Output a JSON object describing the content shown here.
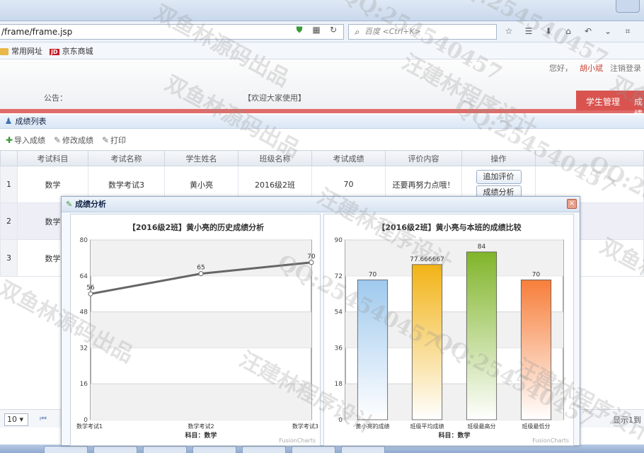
{
  "browser": {
    "url": "/frame/frame.jsp",
    "search_placeholder": "百度 <Ctrl+K>",
    "bookmarks": [
      {
        "label": "常用网址"
      },
      {
        "label": "京东商城"
      }
    ]
  },
  "header": {
    "greeting": "您好，",
    "username": "胡小斌",
    "logout": "注销登录",
    "notice_label": "公告：",
    "notice_text": "【欢迎大家使用】",
    "nav": [
      "学生管理",
      "成绩"
    ]
  },
  "panel": {
    "title": "成绩列表",
    "toolbar": [
      "导入成绩",
      "修改成绩",
      "打印"
    ],
    "columns": [
      "考试科目",
      "考试名称",
      "学生姓名",
      "班级名称",
      "考试成绩",
      "评价内容",
      "操作"
    ],
    "rows": [
      {
        "num": "1",
        "subject": "数学",
        "exam": "数学考试3",
        "student": "黄小亮",
        "class": "2016级2班",
        "score": "70",
        "comment": "还要再努力点哦！"
      },
      {
        "num": "2",
        "subject": "数学",
        "exam": "",
        "student": "",
        "class": "",
        "score": "",
        "comment": ""
      },
      {
        "num": "3",
        "subject": "数学",
        "exam": "",
        "student": "",
        "class": "",
        "score": "",
        "comment": ""
      }
    ],
    "op_buttons": [
      "追加评价",
      "成绩分析"
    ],
    "page_size": "10",
    "pager_info": "显示1到"
  },
  "dialog": {
    "title": "成绩分析",
    "close": "×",
    "fusioncharts": "FusionCharts"
  },
  "chart_data": [
    {
      "type": "line",
      "title": "【2016级2班】黄小亮的历史成绩分析",
      "xlabel": "科目：数学",
      "categories": [
        "数学考试1",
        "数学考试2",
        "数学考试3"
      ],
      "values": [
        56,
        65,
        70
      ],
      "ylim": [
        0,
        80
      ],
      "yticks": [
        0,
        16,
        32,
        48,
        64,
        80
      ],
      "grid": true
    },
    {
      "type": "bar",
      "title": "【2016级2班】黄小亮与本班的成绩比较",
      "xlabel": "科目：数学",
      "categories": [
        "黄小亮的成绩",
        "班级平均成绩",
        "班级最高分",
        "班级最低分"
      ],
      "values": [
        70,
        77.666667,
        84,
        70
      ],
      "value_labels": [
        "70",
        "77.666667",
        "84",
        "70"
      ],
      "colors": [
        "#9fc9ee",
        "#f2b316",
        "#80b52a",
        "#f77e3a"
      ],
      "ylim": [
        0,
        90
      ],
      "yticks": [
        0,
        18,
        36,
        54,
        72,
        90
      ],
      "grid": true
    }
  ],
  "watermarks": [
    "双鱼林源码出品",
    "QQ:254540457",
    "汪建林程序设计",
    "QQ:254540457",
    "双鱼林源码出品",
    "QQ:254540457",
    "汪建林程序设计",
    "QQ:254540457",
    "双鱼林源码出品",
    "汪建林程序设计",
    "QQ:254540457",
    "双鱼林源码出品",
    "QQ:254540457",
    "汪建林程序设计",
    "双鱼林源"
  ]
}
